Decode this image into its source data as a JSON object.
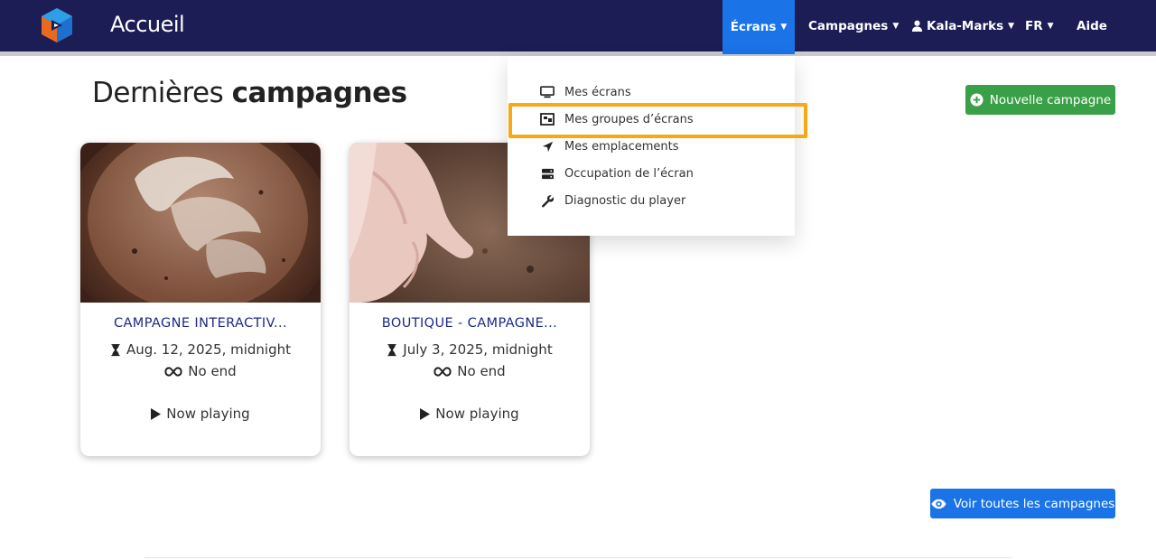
{
  "header": {
    "brand": "Accueil",
    "nav": {
      "screens": "Écrans",
      "campaigns": "Campagnes",
      "user": "Kala-Marks",
      "language": "FR",
      "help": "Aide"
    }
  },
  "dropdown": {
    "items": [
      {
        "label": "Mes écrans",
        "icon": "monitor-icon"
      },
      {
        "label": "Mes groupes d’écrans",
        "icon": "screen-group-icon"
      },
      {
        "label": "Mes emplacements",
        "icon": "location-arrow-icon"
      },
      {
        "label": "Occupation de l’écran",
        "icon": "server-icon"
      },
      {
        "label": "Diagnostic du player",
        "icon": "wrench-icon"
      }
    ],
    "highlighted_index": 1
  },
  "main": {
    "heading_light": "Dernières",
    "heading_bold": "campagnes",
    "new_campaign_label": "Nouvelle campagne",
    "see_all_label": "Voir toutes les campagnes"
  },
  "campaigns": [
    {
      "title": "CAMPAGNE INTERACTIV...",
      "start": "Aug. 12, 2025, midnight",
      "end": "No end",
      "status": "Now playing",
      "image": "latte-art-photo"
    },
    {
      "title": "BOUTIQUE - CAMPAGNE...",
      "start": "July 3, 2025, midnight",
      "end": "No end",
      "status": "Now playing",
      "image": "hand-in-soil-photo"
    }
  ],
  "colors": {
    "navbar": "#1c1d54",
    "accent_blue": "#1a74e8",
    "success_green": "#3aa047",
    "highlight_orange": "#f4a915",
    "card_title": "#1c2a86"
  }
}
